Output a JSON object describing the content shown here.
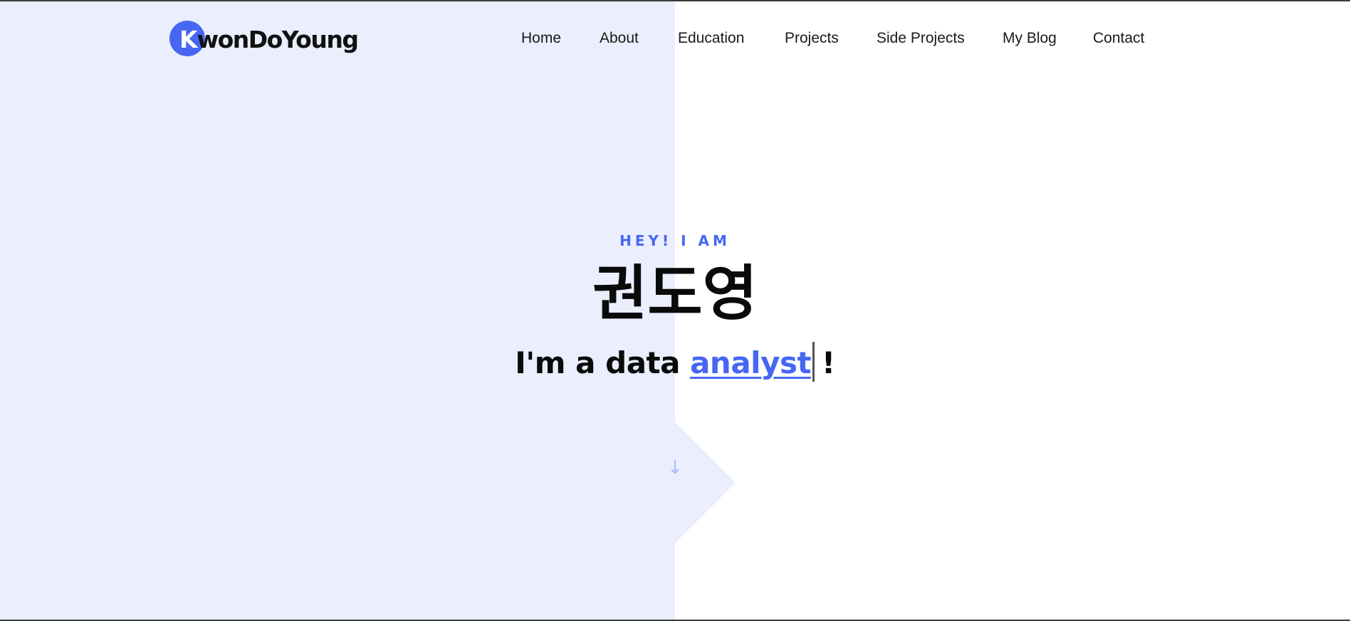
{
  "logo": {
    "initial": "K",
    "rest": "wonDoYoung"
  },
  "nav": {
    "items": [
      {
        "label": "Home"
      },
      {
        "label": "About"
      },
      {
        "label": "Education"
      },
      {
        "label": "Projects"
      },
      {
        "label": "Side Projects"
      },
      {
        "label": "My Blog"
      },
      {
        "label": "Contact"
      }
    ]
  },
  "hero": {
    "eyebrow": "HEY! I AM",
    "name": "권도영",
    "line_prefix": "I'm a data ",
    "role": "analyst",
    "line_suffix": "!"
  },
  "scroll": {
    "icon": "arrow-down-icon"
  },
  "colors": {
    "accent": "#4766f4",
    "panel": "#eaeefd",
    "text": "#0a0a0a"
  }
}
